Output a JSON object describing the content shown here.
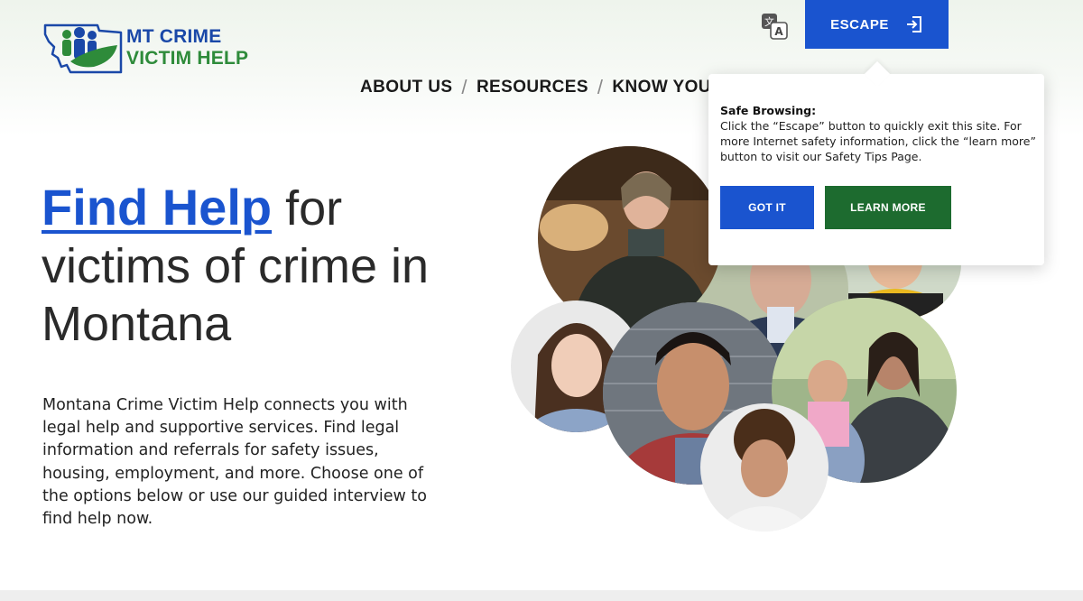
{
  "brand": {
    "line1": "MT CRIME",
    "line2": "VICTIM HELP",
    "blue": "#1a48a8",
    "green": "#2e8b3a"
  },
  "header": {
    "translate_icon": "translate-icon",
    "escape_label": "ESCAPE",
    "escape_icon": "exit-icon",
    "escape_color": "#1a54cf"
  },
  "nav": {
    "items": [
      "ABOUT US",
      "RESOURCES",
      "KNOW YOUR"
    ],
    "separator": "/"
  },
  "hero": {
    "title_link": "Find Help",
    "title_rest1": " for",
    "title_rest2": "victims of crime in",
    "title_rest3": "Montana",
    "body": "Montana Crime Victim Help connects you with legal help and supportive services. Find legal information and referrals for safety issues, housing, employment, and more. Choose one of the options below or use our guided interview to find help now."
  },
  "popover": {
    "title": "Safe Browsing:",
    "text": "Click the “Escape” button to quickly exit this site. For more Internet safety information, click the “learn more” button to visit our Safety Tips Page.",
    "got_it": "GOT IT",
    "learn_more": "LEARN MORE",
    "got_it_color": "#1a54cf",
    "learn_more_color": "#1d6b2f"
  }
}
